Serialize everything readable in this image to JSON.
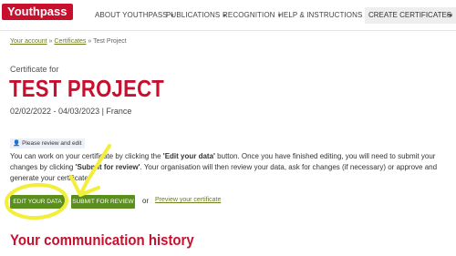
{
  "brand": {
    "logo": "Youthpass",
    "primary_color": "#c8102e",
    "accent_color": "#5a8f1b"
  },
  "nav": {
    "items": [
      {
        "label": "ABOUT YOUTHPASS"
      },
      {
        "label": "PUBLICATIONS"
      },
      {
        "label": "RECOGNITION"
      },
      {
        "label": "HELP & INSTRUCTIONS"
      }
    ],
    "cta_label": "CREATE CERTIFICATES",
    "cta_icon": "exit-icon"
  },
  "breadcrumb": {
    "items": [
      "Your account",
      "Certificates",
      "Test Project"
    ],
    "separator": "»"
  },
  "certificate": {
    "subtitle": "Certificate for",
    "title": "TEST PROJECT",
    "meta": "02/02/2022 - 04/03/2023 | France"
  },
  "status_badge": {
    "label": "Please review and edit",
    "icon": "user-edit-icon"
  },
  "instructions": {
    "part1": "You can work on your certificate by clicking the ",
    "edit_quote": "'Edit your data'",
    "part2": " button. Once you have finished editing, you will need to submit your changes by clicking ",
    "submit_quote": "'Submit for review'",
    "part3": ". Your organisation will then review your data, ask for changes (if necessary) or approve and generate your certificate."
  },
  "actions": {
    "edit_label": "EDIT YOUR DATA",
    "submit_label": "SUBMIT FOR REVIEW",
    "or_text": "or",
    "preview_label": "Preview your certificate"
  },
  "history": {
    "title": "Your communication history"
  },
  "annotation": {
    "color": "#f2ee3a"
  }
}
